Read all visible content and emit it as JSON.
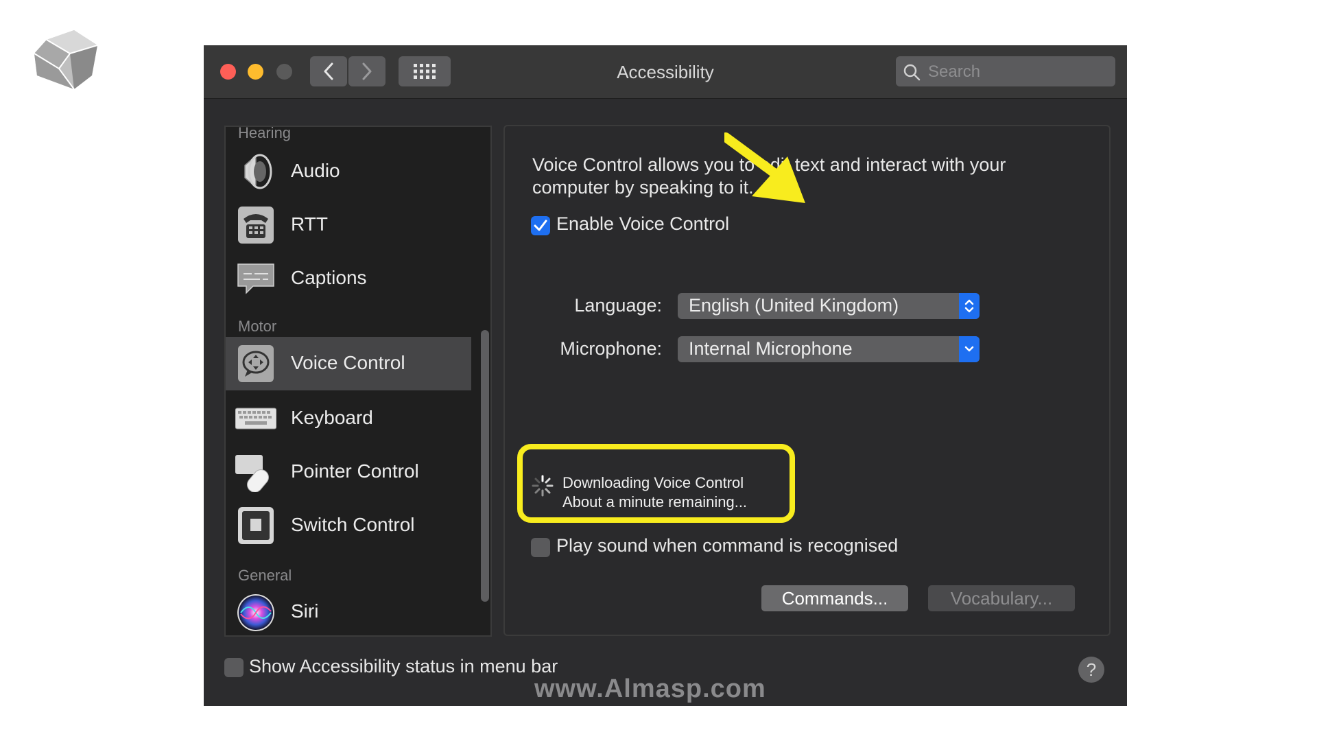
{
  "window": {
    "title": "Accessibility"
  },
  "search": {
    "placeholder": "Search"
  },
  "sidebar": {
    "sections": [
      "Hearing",
      "Motor",
      "General"
    ],
    "items": [
      {
        "label": "Audio",
        "icon": "speaker-icon"
      },
      {
        "label": "RTT",
        "icon": "telephone-icon"
      },
      {
        "label": "Captions",
        "icon": "captions-icon"
      },
      {
        "label": "Voice Control",
        "icon": "voice-control-icon",
        "selected": true
      },
      {
        "label": "Keyboard",
        "icon": "keyboard-icon"
      },
      {
        "label": "Pointer Control",
        "icon": "pointer-control-icon"
      },
      {
        "label": "Switch Control",
        "icon": "switch-control-icon"
      },
      {
        "label": "Siri",
        "icon": "siri-icon"
      }
    ]
  },
  "panel": {
    "description": "Voice Control allows you to edit text and interact with your computer by speaking to it.",
    "enable_label": "Enable Voice Control",
    "enable_checked": true,
    "language_label": "Language:",
    "language_value": "English (United Kingdom)",
    "microphone_label": "Microphone:",
    "microphone_value": "Internal Microphone",
    "download_line1": "Downloading Voice Control",
    "download_line2": "About a minute remaining...",
    "play_sound_label": "Play sound when command is recognised",
    "play_sound_checked": false,
    "commands_button": "Commands...",
    "vocabulary_button": "Vocabulary..."
  },
  "footer": {
    "status_label": "Show Accessibility status in menu bar",
    "status_checked": false,
    "help_label": "?"
  },
  "watermark": "www.Almasp.com",
  "colors": {
    "accent": "#1e6ff1",
    "highlight": "#f8ec1e",
    "close": "#fe5f57",
    "minimize": "#febc2e"
  }
}
